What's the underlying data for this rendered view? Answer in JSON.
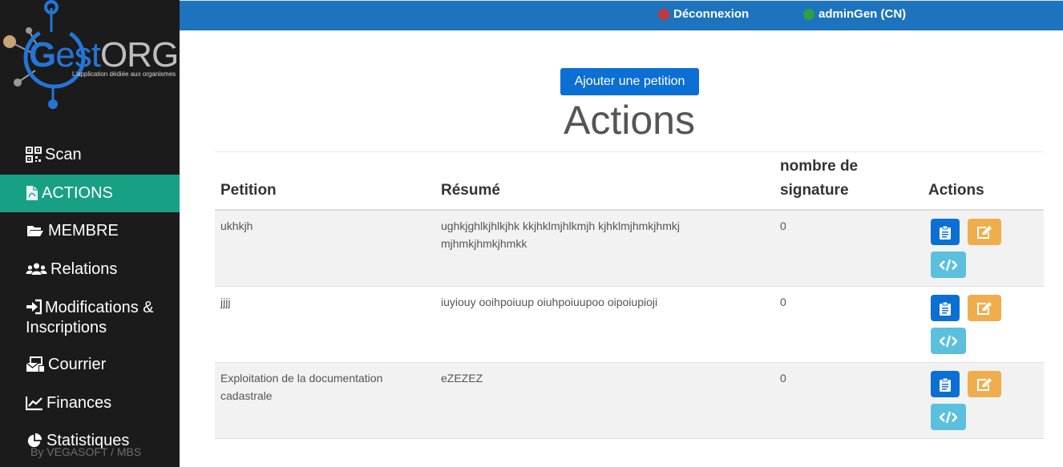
{
  "brand": {
    "name_g": "G",
    "name_est": "est",
    "name_org": "ORG",
    "tagline": "L'application dédiée aux organismes",
    "credit": "By VEGASOFT / MBS"
  },
  "topbar": {
    "logout_label": "Déconnexion",
    "user_label": "adminGen (CN)"
  },
  "sidebar": {
    "items": [
      {
        "label": "Scan",
        "icon": "qrcode-icon"
      },
      {
        "label": "ACTIONS",
        "icon": "file-pdf-icon",
        "active": true
      },
      {
        "label": "MEMBRE",
        "icon": "folder-open-icon"
      },
      {
        "label": "Relations",
        "icon": "users-icon"
      },
      {
        "label": "Modifications & Inscriptions",
        "icon": "sign-in-icon"
      },
      {
        "label": "Courrier",
        "icon": "mail-bulk-icon"
      },
      {
        "label": "Finances",
        "icon": "line-chart-icon"
      },
      {
        "label": "Statistiques",
        "icon": "pie-chart-icon"
      }
    ]
  },
  "main": {
    "add_button_label": "Ajouter une petition",
    "title": "Actions",
    "table": {
      "columns": [
        "Petition",
        "Résumé",
        "nombre de signature",
        "Actions"
      ],
      "rows": [
        {
          "petition": "ukhkjh",
          "resume": "ughkjghlkjhlkjhk kkjhklmjhlkmjh kjhklmjhmkjhmkj mjhmkjhmkjhmkk",
          "signatures": "0"
        },
        {
          "petition": "jjjj",
          "resume": "iuyiouy ooihpoiuup oiuhpoiuupoo oipoiupioji",
          "signatures": "0"
        },
        {
          "petition": "Exploitation de la documentation cadastrale",
          "resume": "eZEZEZ",
          "signatures": "0"
        }
      ]
    }
  },
  "colors": {
    "topbar": "#1e73be",
    "sidebar": "#1b1b1b",
    "active_item": "#18a085",
    "primary_button": "#0b6fd3",
    "edit_button": "#f0ad4e",
    "code_button": "#5bc0de"
  }
}
